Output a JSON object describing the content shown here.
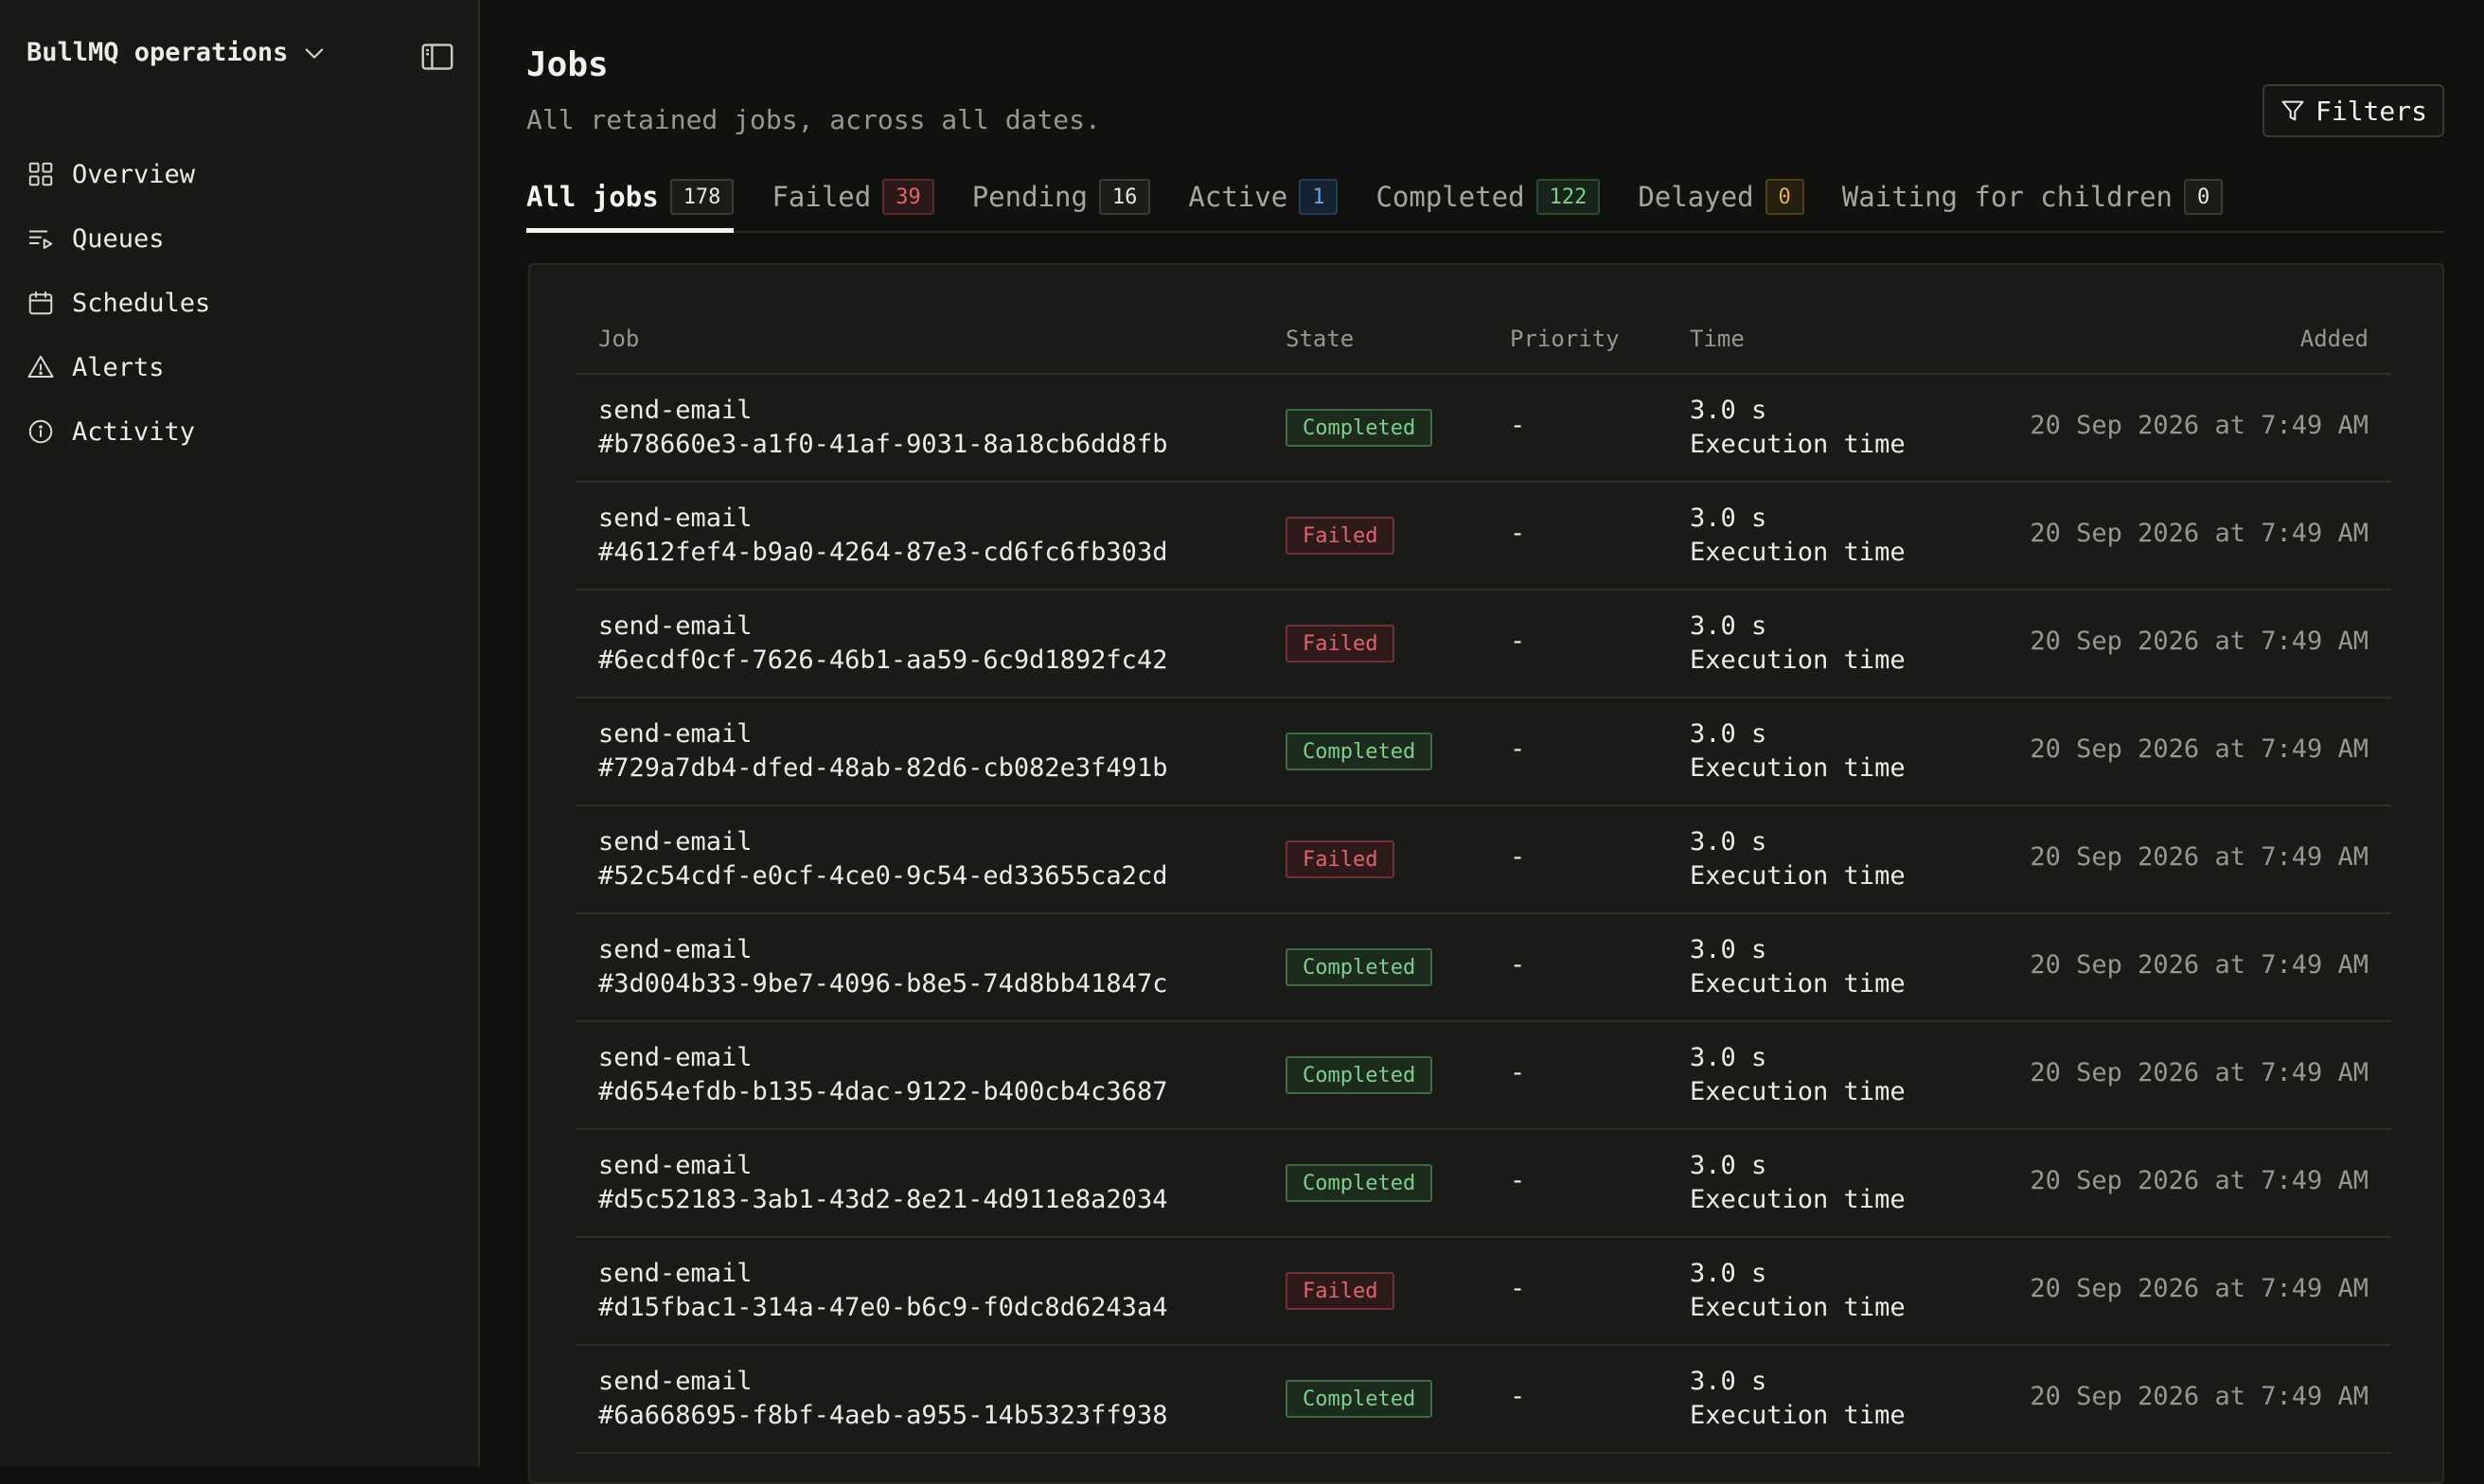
{
  "sidebar": {
    "workspace": "BullMQ operations",
    "items": [
      {
        "label": "Overview",
        "icon": "grid-icon"
      },
      {
        "label": "Queues",
        "icon": "list-play-icon"
      },
      {
        "label": "Schedules",
        "icon": "calendar-icon"
      },
      {
        "label": "Alerts",
        "icon": "warning-triangle-icon"
      },
      {
        "label": "Activity",
        "icon": "info-circle-icon"
      }
    ]
  },
  "header": {
    "title": "Jobs",
    "subtitle": "All retained jobs, across all dates.",
    "filters_label": "Filters"
  },
  "tabs": [
    {
      "label": "All jobs",
      "count": "178",
      "tone": "neutral",
      "active": true
    },
    {
      "label": "Failed",
      "count": "39",
      "tone": "red"
    },
    {
      "label": "Pending",
      "count": "16",
      "tone": "neutral"
    },
    {
      "label": "Active",
      "count": "1",
      "tone": "blue"
    },
    {
      "label": "Completed",
      "count": "122",
      "tone": "green"
    },
    {
      "label": "Delayed",
      "count": "0",
      "tone": "amber"
    },
    {
      "label": "Waiting for children",
      "count": "0",
      "tone": "neutral"
    }
  ],
  "table": {
    "columns": {
      "job": "Job",
      "state": "State",
      "priority": "Priority",
      "time": "Time",
      "added": "Added"
    },
    "rows": [
      {
        "name": "send-email",
        "id": "#b78660e3-a1f0-41af-9031-8a18cb6dd8fb",
        "state": "Completed",
        "priority": "-",
        "time": "3.0 s",
        "time_label": "Execution time",
        "added": "20 Sep 2026 at 7:49 AM"
      },
      {
        "name": "send-email",
        "id": "#4612fef4-b9a0-4264-87e3-cd6fc6fb303d",
        "state": "Failed",
        "priority": "-",
        "time": "3.0 s",
        "time_label": "Execution time",
        "added": "20 Sep 2026 at 7:49 AM"
      },
      {
        "name": "send-email",
        "id": "#6ecdf0cf-7626-46b1-aa59-6c9d1892fc42",
        "state": "Failed",
        "priority": "-",
        "time": "3.0 s",
        "time_label": "Execution time",
        "added": "20 Sep 2026 at 7:49 AM"
      },
      {
        "name": "send-email",
        "id": "#729a7db4-dfed-48ab-82d6-cb082e3f491b",
        "state": "Completed",
        "priority": "-",
        "time": "3.0 s",
        "time_label": "Execution time",
        "added": "20 Sep 2026 at 7:49 AM"
      },
      {
        "name": "send-email",
        "id": "#52c54cdf-e0cf-4ce0-9c54-ed33655ca2cd",
        "state": "Failed",
        "priority": "-",
        "time": "3.0 s",
        "time_label": "Execution time",
        "added": "20 Sep 2026 at 7:49 AM"
      },
      {
        "name": "send-email",
        "id": "#3d004b33-9be7-4096-b8e5-74d8bb41847c",
        "state": "Completed",
        "priority": "-",
        "time": "3.0 s",
        "time_label": "Execution time",
        "added": "20 Sep 2026 at 7:49 AM"
      },
      {
        "name": "send-email",
        "id": "#d654efdb-b135-4dac-9122-b400cb4c3687",
        "state": "Completed",
        "priority": "-",
        "time": "3.0 s",
        "time_label": "Execution time",
        "added": "20 Sep 2026 at 7:49 AM"
      },
      {
        "name": "send-email",
        "id": "#d5c52183-3ab1-43d2-8e21-4d911e8a2034",
        "state": "Completed",
        "priority": "-",
        "time": "3.0 s",
        "time_label": "Execution time",
        "added": "20 Sep 2026 at 7:49 AM"
      },
      {
        "name": "send-email",
        "id": "#d15fbac1-314a-47e0-b6c9-f0dc8d6243a4",
        "state": "Failed",
        "priority": "-",
        "time": "3.0 s",
        "time_label": "Execution time",
        "added": "20 Sep 2026 at 7:49 AM"
      },
      {
        "name": "send-email",
        "id": "#6a668695-f8bf-4aeb-a955-14b5323ff938",
        "state": "Completed",
        "priority": "-",
        "time": "3.0 s",
        "time_label": "Execution time",
        "added": "20 Sep 2026 at 7:49 AM"
      }
    ]
  },
  "colors": {
    "background": "#111110",
    "sidebar": "#181816",
    "completed": "#7fcf8a",
    "failed": "#e0656a",
    "active": "#6aa6e8",
    "delayed": "#e0b455"
  }
}
